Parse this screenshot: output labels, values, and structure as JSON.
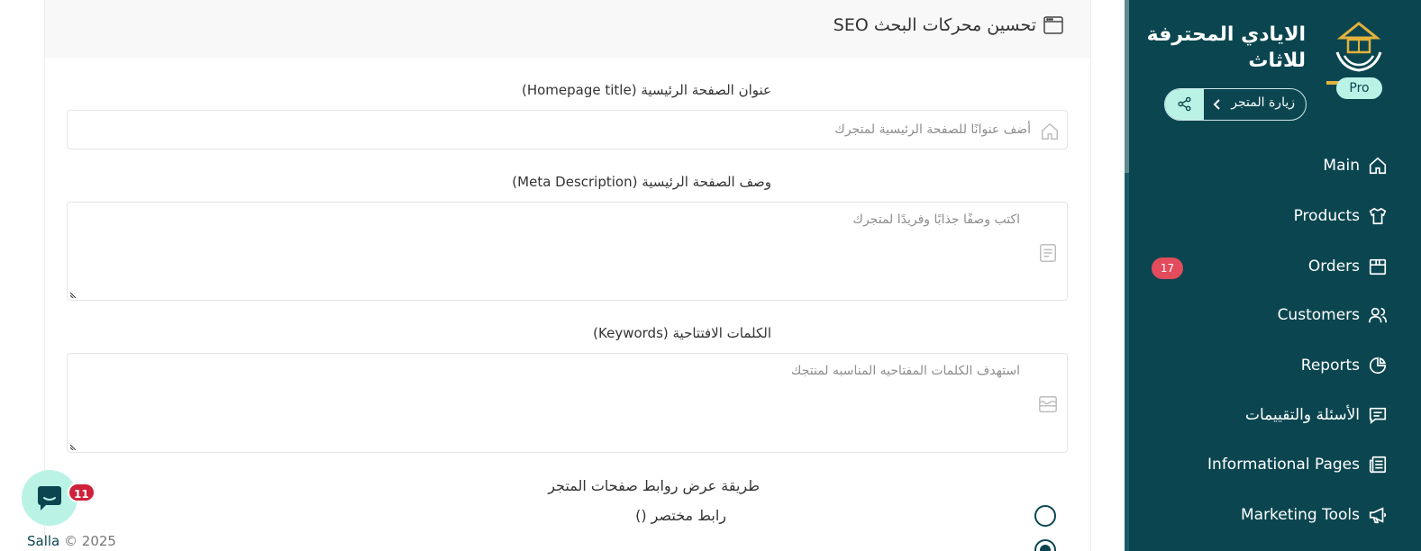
{
  "seo": {
    "title": "تحسين محركات البحث SEO",
    "homepage_title_label": "عنوان الصفحة الرئيسية (Homepage title)",
    "homepage_title_placeholder": "أضف عنوانًا للصفحة الرئيسية لمتجرك",
    "meta_label": "وصف الصفحة الرئيسية (Meta Description)",
    "meta_placeholder": "اكتب وصفًا جذابًا وفريدًا لمتجرك",
    "keywords_label": "الكلمات الافتتاحية (Keywords)",
    "keywords_placeholder": "استهدف الكلمات المفتاحيه المناسبه لمنتجك",
    "links_label": "طريقة عرض روابط صفحات المتجر",
    "option_short": "رابط مختصر ()",
    "option_short_selected": false,
    "option_second_selected": true
  },
  "chat": {
    "badge": "11"
  },
  "footer": {
    "brand": "Salla",
    "text": " © 2025"
  },
  "sidebar": {
    "store_name": "الايادي المحترفة للاثاث",
    "plan_badge": "Pro",
    "visit_store": "زيارة المتجر",
    "items": [
      {
        "label": "Main",
        "icon": "home-icon"
      },
      {
        "label": "Products",
        "icon": "shirt-icon"
      },
      {
        "label": "Orders",
        "icon": "box-icon",
        "badge": "17"
      },
      {
        "label": "Customers",
        "icon": "users-icon"
      },
      {
        "label": "Reports",
        "icon": "pie-chart-icon"
      },
      {
        "label": "الأسئلة والتقييمات",
        "icon": "comment-icon"
      },
      {
        "label": "Informational Pages",
        "icon": "newspaper-icon"
      },
      {
        "label": "Marketing Tools",
        "icon": "megaphone-icon"
      }
    ]
  },
  "colors": {
    "primary": "#0b4650",
    "accent": "#baf3e6",
    "badge": "#e24c5c"
  }
}
